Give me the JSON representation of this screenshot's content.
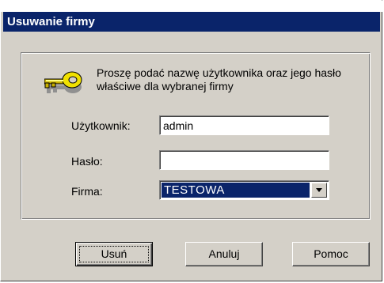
{
  "window": {
    "title": "Usuwanie firmy"
  },
  "instruction": "Proszę podać nazwę użytkownika oraz jego hasło właściwe dla wybranej firmy",
  "icons": {
    "key": "key-icon"
  },
  "form": {
    "user_label": "Użytkownik:",
    "user_value": "admin",
    "password_label": "Hasło:",
    "password_value": "",
    "company_label": "Firma:",
    "company_value": "TESTOWA"
  },
  "buttons": {
    "delete_label": "Usuń",
    "cancel_label": "Anuluj",
    "help_label": "Pomoc"
  },
  "colors": {
    "title_bar": "#0a246a",
    "dialog_face": "#d4d0c8",
    "selection": "#0a246a"
  }
}
